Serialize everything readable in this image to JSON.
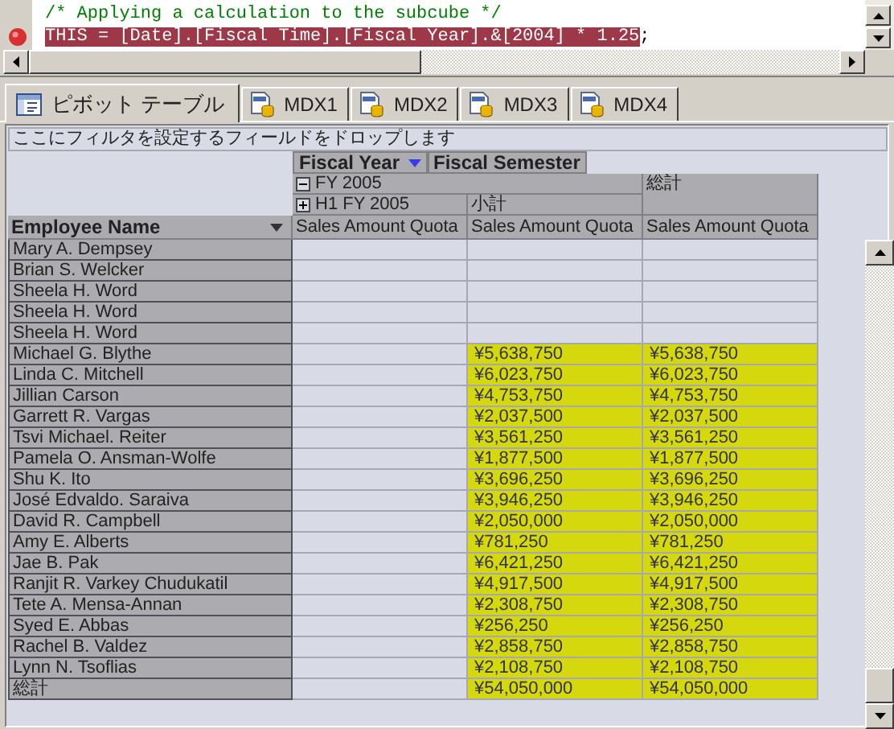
{
  "editor": {
    "lines": [
      {
        "kind": "comment",
        "text": "/* Applying a calculation to the subcube */",
        "breakpoint": false
      },
      {
        "kind": "code",
        "text": "THIS = [Date].[Fiscal Time].[Fiscal Year].&[2004] * 1.25",
        "suffix": ";",
        "breakpoint": true
      }
    ]
  },
  "tabs": [
    {
      "kind": "pivot",
      "label": "ピボット テーブル",
      "selected": true
    },
    {
      "kind": "mdx",
      "label": "MDX1",
      "selected": false
    },
    {
      "kind": "mdx",
      "label": "MDX2",
      "selected": false
    },
    {
      "kind": "mdx",
      "label": "MDX3",
      "selected": false
    },
    {
      "kind": "mdx",
      "label": "MDX4",
      "selected": false
    }
  ],
  "pivot": {
    "filter_hint": "ここにフィルタを設定するフィールドをドロップします",
    "column_fields": [
      {
        "label": "Fiscal Year",
        "dropdown": true
      },
      {
        "label": "Fiscal Semester",
        "dropdown": false
      }
    ],
    "year": {
      "label": "FY 2005",
      "expanded": true
    },
    "semester": {
      "label": "H1 FY 2005",
      "expanded": false
    },
    "subtotal_label": "小計",
    "grand_total_label": "総計",
    "measures": [
      "Sales Amount Quota",
      "Sales Amount Quota",
      "Sales Amount Quota"
    ],
    "row_field": "Employee Name",
    "rows": [
      {
        "name": "Mary A. Dempsey"
      },
      {
        "name": "Brian S. Welcker"
      },
      {
        "name": "Sheela H. Word"
      },
      {
        "name": "Sheela H. Word"
      },
      {
        "name": "Sheela H. Word"
      },
      {
        "name": "Michael G. Blythe",
        "subtotal": "¥5,638,750",
        "total": "¥5,638,750"
      },
      {
        "name": "Linda C. Mitchell",
        "subtotal": "¥6,023,750",
        "total": "¥6,023,750"
      },
      {
        "name": "Jillian Carson",
        "subtotal": "¥4,753,750",
        "total": "¥4,753,750"
      },
      {
        "name": "Garrett R. Vargas",
        "subtotal": "¥2,037,500",
        "total": "¥2,037,500"
      },
      {
        "name": "Tsvi Michael. Reiter",
        "subtotal": "¥3,561,250",
        "total": "¥3,561,250"
      },
      {
        "name": "Pamela O. Ansman-Wolfe",
        "subtotal": "¥1,877,500",
        "total": "¥1,877,500"
      },
      {
        "name": "Shu K. Ito",
        "subtotal": "¥3,696,250",
        "total": "¥3,696,250"
      },
      {
        "name": "José Edvaldo. Saraiva",
        "subtotal": "¥3,946,250",
        "total": "¥3,946,250"
      },
      {
        "name": "David R. Campbell",
        "subtotal": "¥2,050,000",
        "total": "¥2,050,000"
      },
      {
        "name": "Amy E. Alberts",
        "subtotal": "¥781,250",
        "total": "¥781,250"
      },
      {
        "name": "Jae B. Pak",
        "subtotal": "¥6,421,250",
        "total": "¥6,421,250"
      },
      {
        "name": "Ranjit R. Varkey Chudukatil",
        "subtotal": "¥4,917,500",
        "total": "¥4,917,500"
      },
      {
        "name": "Tete A. Mensa-Annan",
        "subtotal": "¥2,308,750",
        "total": "¥2,308,750"
      },
      {
        "name": "Syed E. Abbas",
        "subtotal": "¥256,250",
        "total": "¥256,250"
      },
      {
        "name": "Rachel B. Valdez",
        "subtotal": "¥2,858,750",
        "total": "¥2,858,750"
      },
      {
        "name": "Lynn N. Tsoflias",
        "subtotal": "¥2,108,750",
        "total": "¥2,108,750"
      },
      {
        "name": "総計",
        "subtotal": "¥54,050,000",
        "total": "¥54,050,000"
      }
    ]
  }
}
